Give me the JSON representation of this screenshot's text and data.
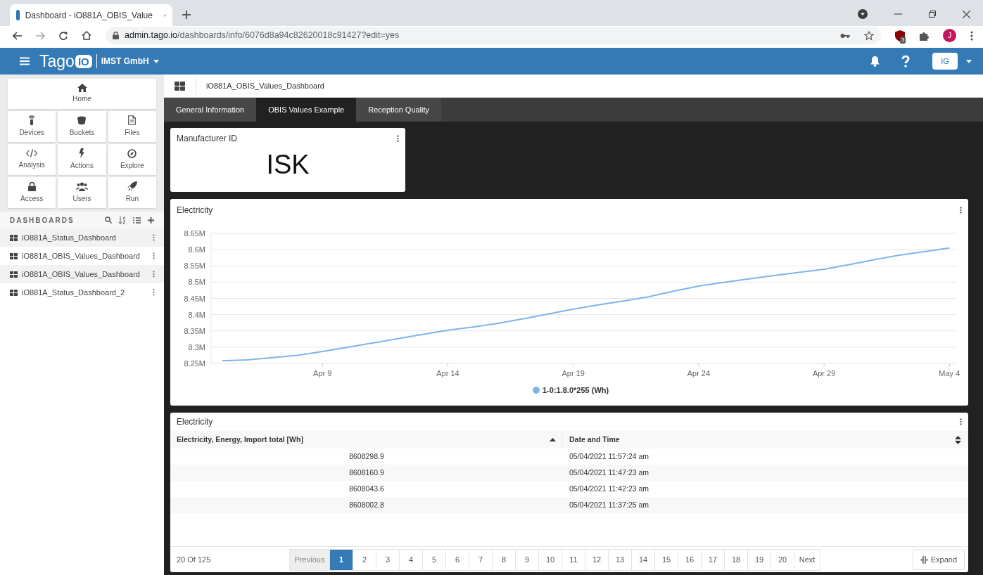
{
  "browser": {
    "tab_title": "Dashboard - iO881A_OBIS_Value",
    "url_host": "admin.tago.io",
    "url_path": "/dashboards/info/6076d8a94c82620018c91427?edit=yes",
    "extension_badge": "3",
    "profile_initial": "J"
  },
  "header": {
    "logo_text": "Tago",
    "logo_mark": "IO",
    "account": "IMST GmbH",
    "user_initials": "IG"
  },
  "sidebar": {
    "home": "Home",
    "tiles": [
      "Devices",
      "Buckets",
      "Files",
      "Analysis",
      "Actions",
      "Explore",
      "Access",
      "Users",
      "Run"
    ],
    "dashboards_heading": "DASHBOARDS",
    "dashboards": [
      {
        "label": "iO881A_Status_Dashboard"
      },
      {
        "label": "iO881A_OBIS_Values_Dashboard"
      },
      {
        "label": "iO881A_OBIS_Values_Dashboard"
      },
      {
        "label": "iO881A_Status_Dashboard_2"
      }
    ]
  },
  "dashboard": {
    "title": "iO881A_OBIS_Values_Dashboard",
    "tabs": [
      {
        "label": "General Information",
        "selected": false
      },
      {
        "label": "OBIS Values Example",
        "selected": true
      },
      {
        "label": "Reception Quality",
        "selected": false
      }
    ],
    "manufacturer_widget": {
      "title": "Manufacturer ID",
      "value": "ISK"
    },
    "chart_widget": {
      "title": "Electricity",
      "chart_data": {
        "type": "line",
        "categories": [
          null,
          null,
          null,
          null,
          "Apr 9",
          null,
          null,
          null,
          null,
          "Apr 14",
          null,
          null,
          null,
          null,
          "Apr 19",
          null,
          null,
          null,
          null,
          "Apr 24",
          null,
          null,
          null,
          null,
          "Apr 29",
          null,
          null,
          null,
          null,
          "May 4"
        ],
        "series": [
          {
            "name": "1-0:1.8.0*255 (Wh)",
            "color": "#7cb5ec",
            "values": [
              8258000,
              8261000,
              8268000,
              8275000,
              8287000,
              8300000,
              8313000,
              8326000,
              8339000,
              8352000,
              8362000,
              8373000,
              8387000,
              8402000,
              8417000,
              8430000,
              8442000,
              8455000,
              8472000,
              8488000,
              8499000,
              8510000,
              8520000,
              8530000,
              8540000,
              8554000,
              8569000,
              8583000,
              8594000,
              8605000
            ]
          }
        ],
        "ylim": [
          8250000,
          8650000
        ],
        "grid": true,
        "yticks": [
          {
            "value": 8250000,
            "label": "8.25M"
          },
          {
            "value": 8300000,
            "label": "8.3M"
          },
          {
            "value": 8350000,
            "label": "8.35M"
          },
          {
            "value": 8400000,
            "label": "8.4M"
          },
          {
            "value": 8450000,
            "label": "8.45M"
          },
          {
            "value": 8500000,
            "label": "8.5M"
          },
          {
            "value": 8550000,
            "label": "8.55M"
          },
          {
            "value": 8600000,
            "label": "8.6M"
          },
          {
            "value": 8650000,
            "label": "8.65M"
          }
        ]
      }
    },
    "table_widget": {
      "title": "Electricity",
      "columns": [
        {
          "label": "Electricity, Energy, Import total [Wh]",
          "sorted": true
        },
        {
          "label": "Date and Time",
          "sorted": false
        }
      ],
      "rows": [
        [
          "8608298.9",
          "05/04/2021 11:57:24 am"
        ],
        [
          "8608160.9",
          "05/04/2021 11:47:23 am"
        ],
        [
          "8608043.6",
          "05/04/2021 11:42:23 am"
        ],
        [
          "8608002.8",
          "05/04/2021 11:37:25 am"
        ]
      ],
      "count": "20 Of 125",
      "previous": {
        "label": "Previous",
        "disabled": true
      },
      "pages": [
        {
          "label": "1",
          "selected": true
        },
        {
          "label": "2",
          "selected": false
        },
        {
          "label": "3",
          "selected": false
        },
        {
          "label": "4",
          "selected": false
        },
        {
          "label": "5",
          "selected": false
        },
        {
          "label": "6",
          "selected": false
        },
        {
          "label": "7",
          "selected": false
        },
        {
          "label": "8",
          "selected": false
        },
        {
          "label": "9",
          "selected": false
        },
        {
          "label": "10",
          "selected": false
        },
        {
          "label": "11",
          "selected": false
        },
        {
          "label": "12",
          "selected": false
        },
        {
          "label": "13",
          "selected": false
        },
        {
          "label": "14",
          "selected": false
        },
        {
          "label": "15",
          "selected": false
        },
        {
          "label": "16",
          "selected": false
        },
        {
          "label": "17",
          "selected": false
        },
        {
          "label": "18",
          "selected": false
        },
        {
          "label": "19",
          "selected": false
        },
        {
          "label": "20",
          "selected": false
        }
      ],
      "next": {
        "label": "Next",
        "disabled": false
      },
      "expand": "Expand"
    }
  }
}
